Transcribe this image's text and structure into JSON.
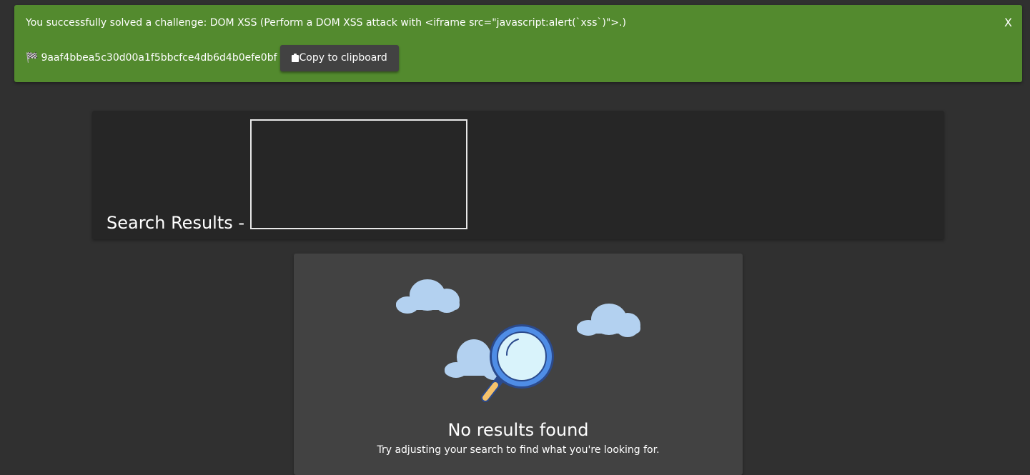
{
  "notification": {
    "message": "You successfully solved a challenge: DOM XSS (Perform a DOM XSS attack with <iframe src=\"javascript:alert(`xss`)\">.)",
    "close_label": "X",
    "flag_code": "9aaf4bbea5c30d00a1f5bbcfce4db6d4b0efe0bf",
    "copy_label": "Copy to clipboard",
    "background_color": "#538a2e"
  },
  "search": {
    "title": "Search Results -"
  },
  "empty_state": {
    "title": "No results found",
    "subtitle": "Try adjusting your search to find what you're looking for."
  }
}
